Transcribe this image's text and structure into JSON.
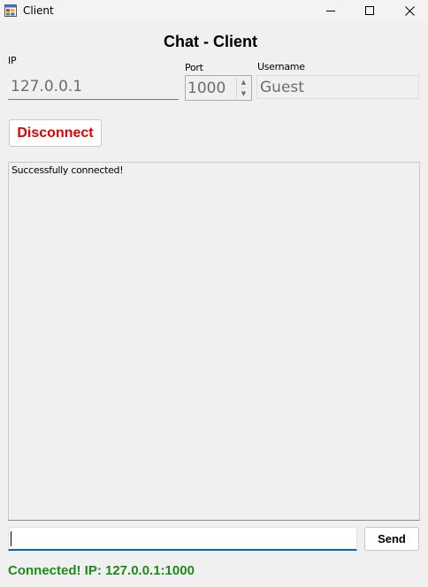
{
  "window": {
    "title": "Client"
  },
  "header": {
    "title": "Chat - Client"
  },
  "connection": {
    "ip_label": "IP",
    "ip_value": "127.0.0.1",
    "port_label": "Port",
    "port_value": "1000",
    "username_label": "Username",
    "username_value": "Guest",
    "disconnect_label": "Disconnect"
  },
  "log": {
    "text": "Successfully connected!"
  },
  "compose": {
    "input_value": "",
    "send_label": "Send"
  },
  "status": {
    "text": "Connected! IP: 127.0.0.1:1000"
  },
  "colors": {
    "disconnect_text": "#e00000",
    "status_text": "#1c8a1c",
    "input_focus": "#0067c0"
  },
  "icons": {
    "app": "winforms-app-icon",
    "minimize": "minimize-icon",
    "maximize": "maximize-icon",
    "close": "close-icon",
    "spin_up": "chevron-up-icon",
    "spin_down": "chevron-down-icon"
  }
}
